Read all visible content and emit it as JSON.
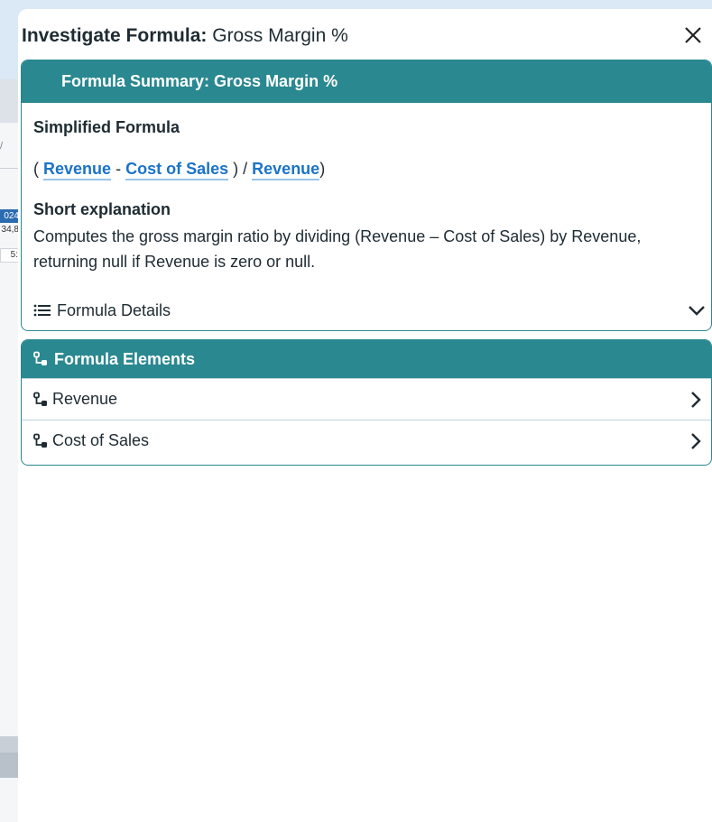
{
  "background": {
    "cells": [
      "024",
      "34,8",
      "5:"
    ]
  },
  "panel": {
    "title_prefix": "Investigate Formula:",
    "title_name": "Gross Margin %",
    "close_icon": "close-icon"
  },
  "summary": {
    "header": "Formula Summary: Gross Margin %",
    "simplified_label": "Simplified Formula",
    "formula": {
      "open_paren": "(",
      "term1": "Revenue",
      "minus": "-",
      "term2": "Cost of Sales",
      "close_div": ") /",
      "term3": "Revenue",
      "close_paren": ")"
    },
    "short_label": "Short explanation",
    "explanation": "Computes the gross margin ratio by dividing (Revenue – Cost of Sales) by Revenue, returning null if Revenue is zero or null.",
    "details_label": "Formula Details"
  },
  "elements": {
    "header": "Formula Elements",
    "items": [
      {
        "label": "Revenue"
      },
      {
        "label": "Cost of Sales"
      }
    ]
  },
  "colors": {
    "accent": "#2a8890",
    "link": "#1a73c9"
  }
}
